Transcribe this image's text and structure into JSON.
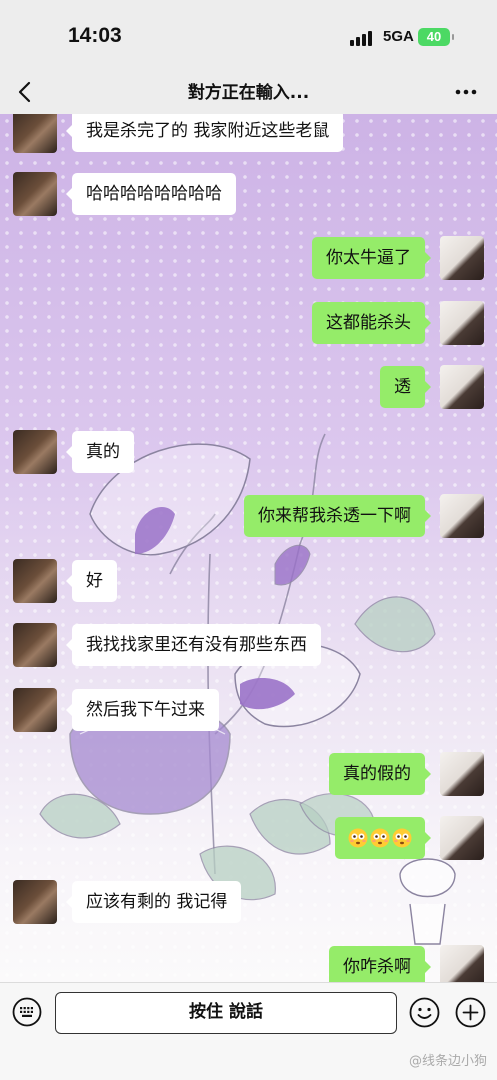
{
  "status_bar": {
    "time": "14:03",
    "network": "5GA",
    "battery": "40"
  },
  "nav": {
    "title": "對方正在輸入..."
  },
  "messages": [
    {
      "side": "left",
      "text": "我是杀完了的 我家附近这些老鼠"
    },
    {
      "side": "left",
      "text": "哈哈哈哈哈哈哈哈"
    },
    {
      "side": "right",
      "text": "你太牛逼了"
    },
    {
      "side": "right",
      "text": "这都能杀头"
    },
    {
      "side": "right",
      "text": "透"
    },
    {
      "side": "left",
      "text": "真的"
    },
    {
      "side": "right",
      "text": "你来帮我杀透一下啊"
    },
    {
      "side": "left",
      "text": "好"
    },
    {
      "side": "left",
      "text": "我找找家里还有没有那些东西"
    },
    {
      "side": "left",
      "text": "然后我下午过来"
    },
    {
      "side": "right",
      "text": "真的假的"
    },
    {
      "side": "right",
      "emoji": [
        "flushed-face",
        "flushed-face",
        "flushed-face"
      ]
    },
    {
      "side": "left",
      "text": "应该有剩的 我记得"
    },
    {
      "side": "right",
      "text": "你咋杀啊"
    }
  ],
  "input_bar": {
    "hold_to_talk": "按住 說話"
  },
  "watermark": "@线条边小狗",
  "colors": {
    "sent_bubble": "#95ec69",
    "received_bubble": "#ffffff",
    "battery": "#4cd964"
  }
}
